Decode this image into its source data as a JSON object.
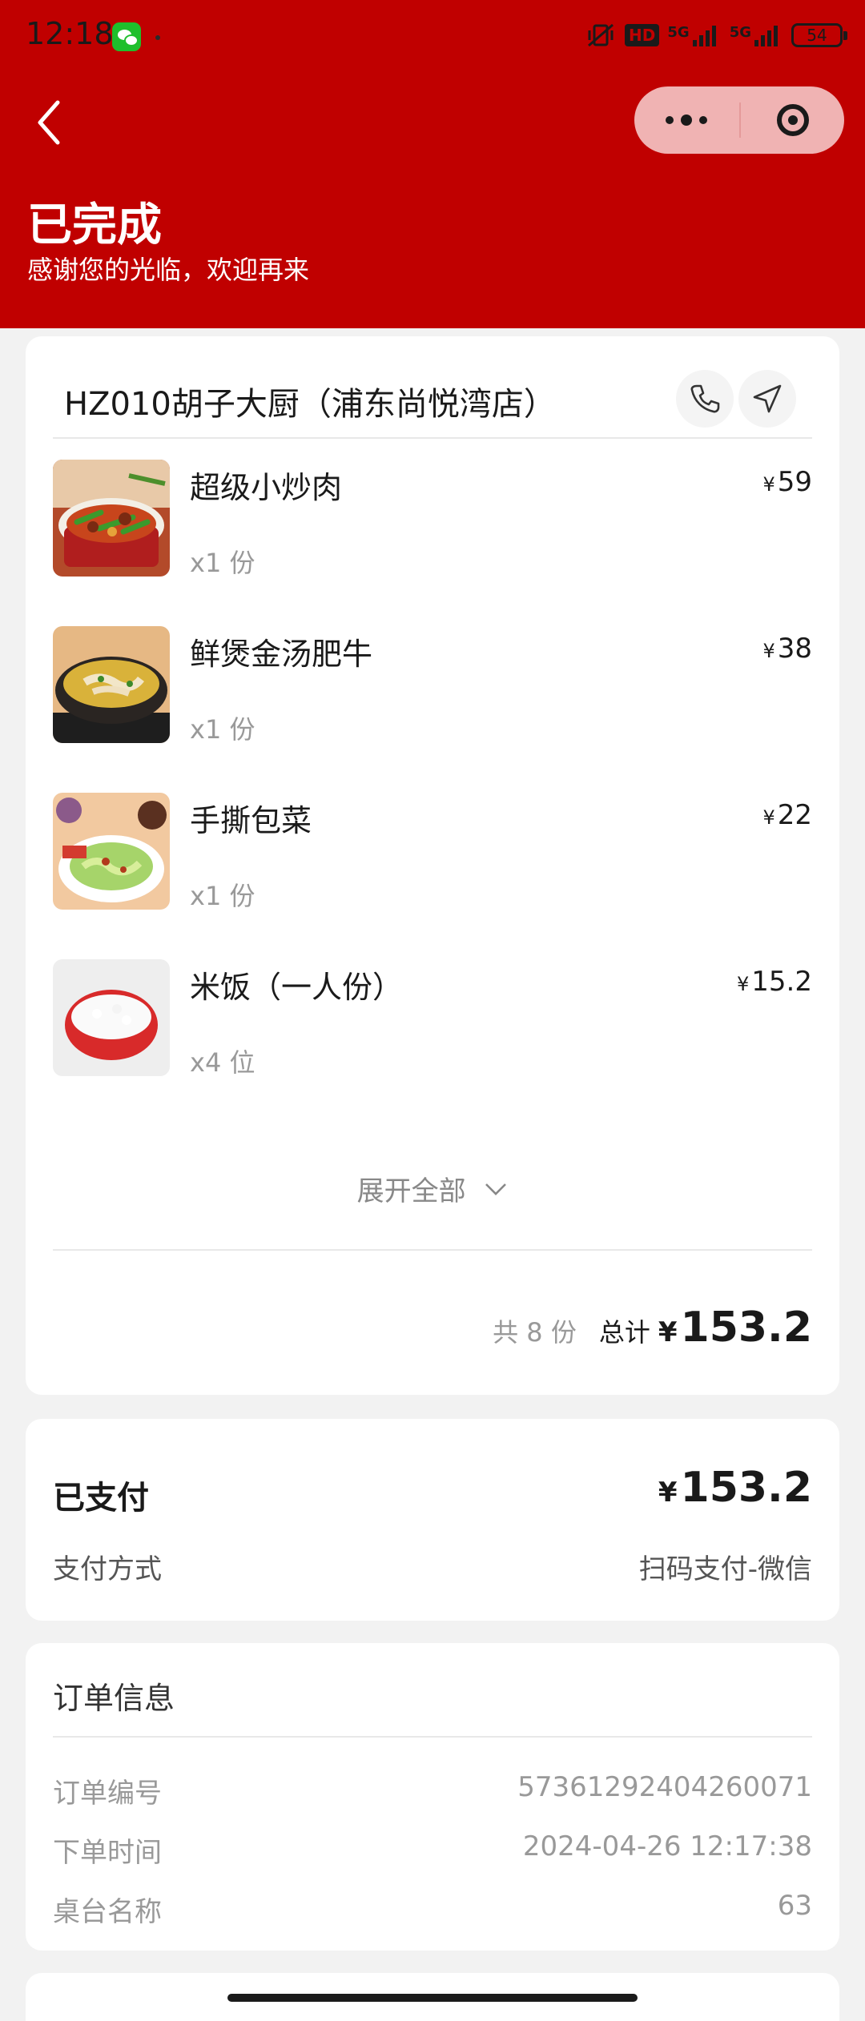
{
  "status_bar": {
    "time": "12:18",
    "hd_label": "HD",
    "sig1": "5G",
    "sig2": "5G",
    "battery": "54"
  },
  "header": {
    "title": "已完成",
    "subtitle": "感谢您的光临，欢迎再来"
  },
  "store": {
    "name": "HZ010胡子大厨（浦东尚悦湾店）"
  },
  "currency": "¥",
  "items": [
    {
      "name": "超级小炒肉",
      "qty": "x1 份",
      "price": "59"
    },
    {
      "name": "鲜煲金汤肥牛",
      "qty": "x1 份",
      "price": "38"
    },
    {
      "name": "手撕包菜",
      "qty": "x1 份",
      "price": "22"
    },
    {
      "name": "米饭（一人份）",
      "qty": "x4 位",
      "price": "15.2"
    }
  ],
  "expand_label": "展开全部",
  "summary": {
    "count": "共 8 份",
    "total_label": "总计",
    "total": "153.2"
  },
  "payment": {
    "title": "已支付",
    "amount": "153.2",
    "method_label": "支付方式",
    "method_value": "扫码支付-微信"
  },
  "order": {
    "title": "订单信息",
    "rows": [
      {
        "label": "订单编号",
        "value": "57361292404260071"
      },
      {
        "label": "下单时间",
        "value": "2024-04-26 12:17:38"
      },
      {
        "label": "桌台名称",
        "value": "63"
      }
    ]
  },
  "colors": {
    "header_bg": "#c00000",
    "capsule_bg": "#f0b3b3",
    "page_bg": "#f2f2f2"
  }
}
